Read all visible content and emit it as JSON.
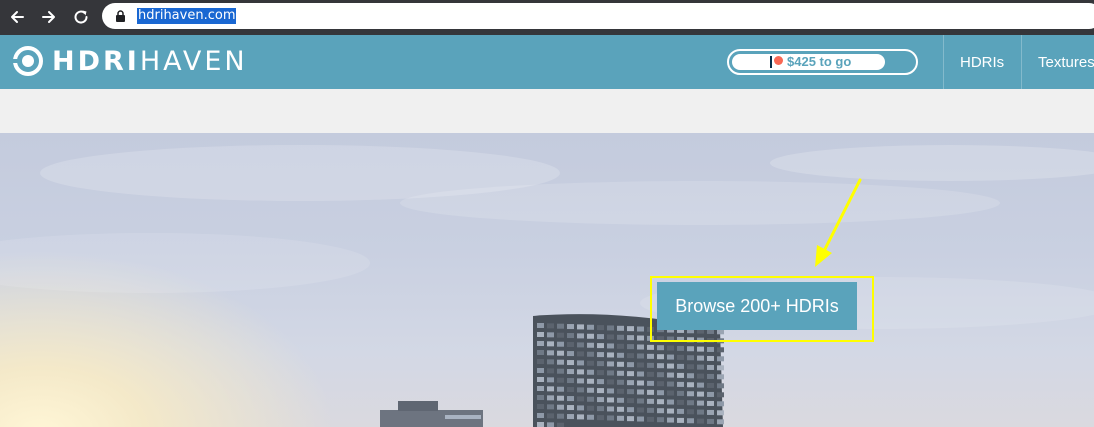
{
  "browser": {
    "url": "hdrihaven.com",
    "back_icon": "arrow-left-icon",
    "forward_icon": "arrow-right-icon",
    "reload_icon": "reload-icon",
    "lock_icon": "lock-icon"
  },
  "header": {
    "logo_bold": "HDRI",
    "logo_light": "HAVEN",
    "patreon": {
      "goal_text": "$425 to go"
    },
    "nav": [
      {
        "label": "HDRIs"
      },
      {
        "label": "Textures"
      }
    ]
  },
  "hero": {
    "cta_label": "Browse 200+ HDRIs"
  },
  "colors": {
    "brand": "#5aa3bb",
    "patreon": "#f96854",
    "annotation": "#ffff00",
    "url_highlight": "#1967d2"
  }
}
